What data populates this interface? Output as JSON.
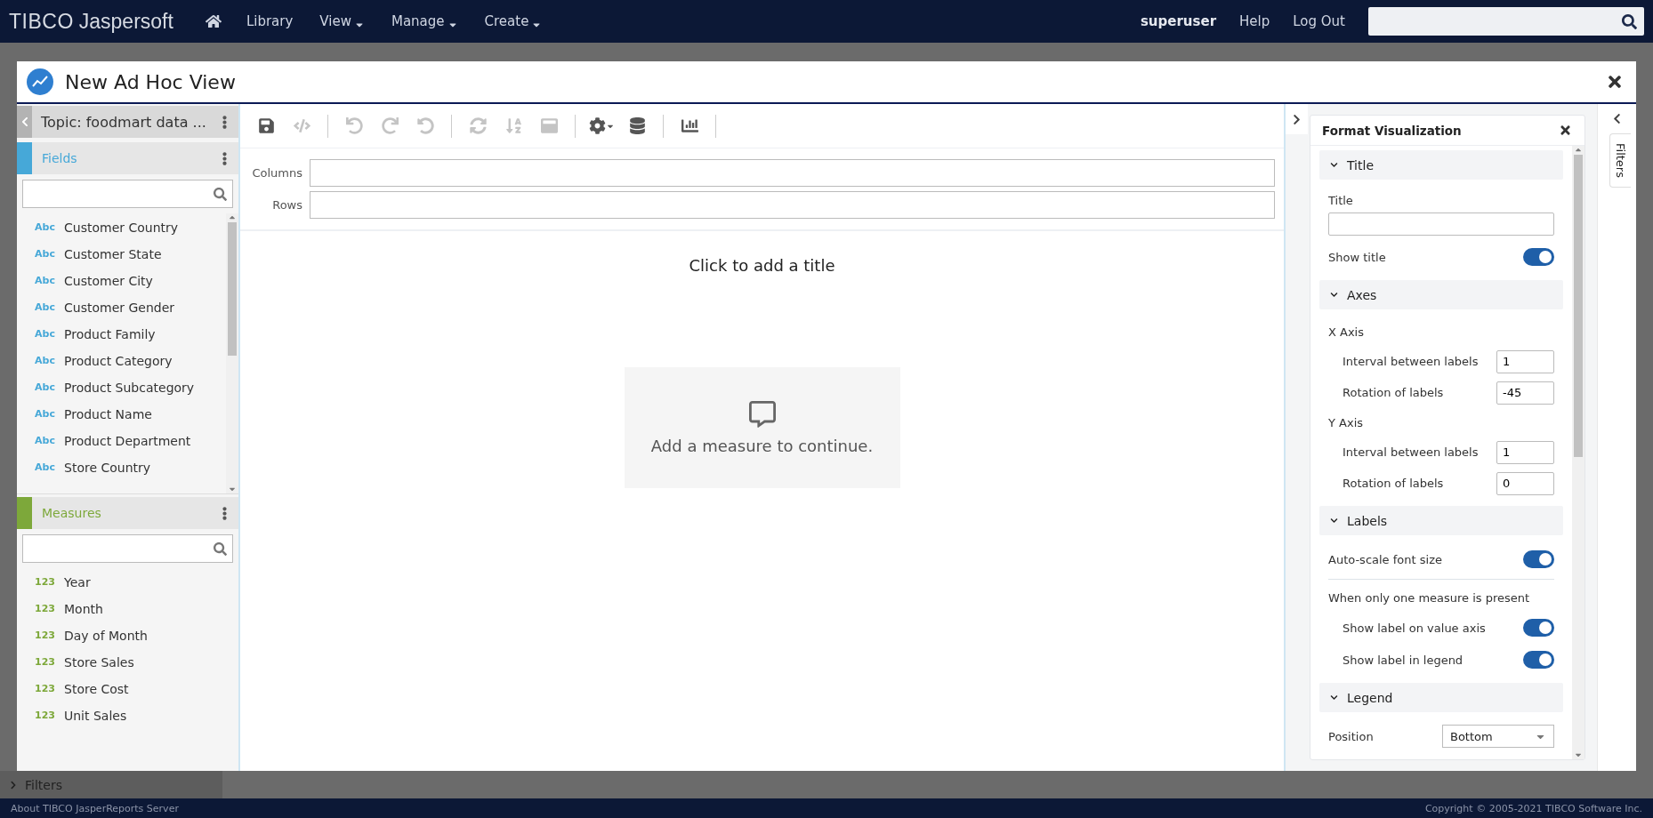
{
  "topbar": {
    "logo": {
      "brand": "TIBCO",
      "product": "Jaspersoft"
    },
    "nav": [
      {
        "label": "Library",
        "has_menu": false
      },
      {
        "label": "View",
        "has_menu": true
      },
      {
        "label": "Manage",
        "has_menu": true
      },
      {
        "label": "Create",
        "has_menu": true
      }
    ],
    "user": "superuser",
    "links": [
      "Help",
      "Log Out"
    ]
  },
  "background": {
    "filters_label": "Filters"
  },
  "dialog": {
    "title": "New Ad Hoc View",
    "data_panel": {
      "topic": "Topic: foodmart data ...",
      "sections": [
        {
          "title": "Fields",
          "color": "#46a8d8",
          "items": [
            {
              "type": "Abc",
              "name": "Customer Country"
            },
            {
              "type": "Abc",
              "name": "Customer State"
            },
            {
              "type": "Abc",
              "name": "Customer City"
            },
            {
              "type": "Abc",
              "name": "Customer Gender"
            },
            {
              "type": "Abc",
              "name": "Product Family"
            },
            {
              "type": "Abc",
              "name": "Product Category"
            },
            {
              "type": "Abc",
              "name": "Product Subcategory"
            },
            {
              "type": "Abc",
              "name": "Product Name"
            },
            {
              "type": "Abc",
              "name": "Product Department"
            },
            {
              "type": "Abc",
              "name": "Store Country"
            }
          ]
        },
        {
          "title": "Measures",
          "color": "#7da83a",
          "items": [
            {
              "type": "123",
              "name": "Year"
            },
            {
              "type": "123",
              "name": "Month"
            },
            {
              "type": "123",
              "name": "Day of Month"
            },
            {
              "type": "123",
              "name": "Store Sales"
            },
            {
              "type": "123",
              "name": "Store Cost"
            },
            {
              "type": "123",
              "name": "Unit Sales"
            }
          ]
        }
      ]
    },
    "toolbar": [
      [
        {
          "kind": "save",
          "disabled": false
        },
        {
          "kind": "code",
          "disabled": true
        }
      ],
      [
        {
          "kind": "undo",
          "disabled": true
        },
        {
          "kind": "redo",
          "disabled": true
        },
        {
          "kind": "undo_all",
          "disabled": true
        }
      ],
      [
        {
          "kind": "pivot",
          "disabled": true
        },
        {
          "kind": "sort",
          "disabled": true
        },
        {
          "kind": "layout",
          "disabled": true
        }
      ],
      [
        {
          "kind": "settings",
          "disabled": false
        },
        {
          "kind": "data_info",
          "disabled": false
        }
      ],
      [
        {
          "kind": "chart",
          "disabled": false
        }
      ]
    ],
    "axes": [
      {
        "label": "Columns"
      },
      {
        "label": "Rows"
      }
    ],
    "canvas": {
      "title_hint": "Click to add a title",
      "message": "Add a measure to continue."
    },
    "format_panel": {
      "title": "Format Visualization",
      "sections": [
        {
          "title": "Title",
          "expanded": true,
          "rows": [
            {
              "kind": "field",
              "label": "Title",
              "value": ""
            },
            {
              "kind": "toggle",
              "label": "Show title",
              "on": true
            }
          ]
        },
        {
          "title": "Axes",
          "expanded": true,
          "rows": [
            {
              "kind": "group",
              "label": "X Axis",
              "children": [
                {
                  "kind": "number",
                  "label": "Interval between labels",
                  "value": "1"
                },
                {
                  "kind": "number",
                  "label": "Rotation of labels",
                  "value": "-45"
                }
              ]
            },
            {
              "kind": "group",
              "label": "Y Axis",
              "children": [
                {
                  "kind": "number",
                  "label": "Interval between labels",
                  "value": "1"
                },
                {
                  "kind": "number",
                  "label": "Rotation of labels",
                  "value": "0"
                }
              ]
            }
          ]
        },
        {
          "title": "Labels",
          "expanded": true,
          "rows": [
            {
              "kind": "toggle",
              "label": "Auto-scale font size",
              "on": true
            },
            {
              "kind": "divider"
            },
            {
              "kind": "group",
              "label": "When only one measure is present",
              "children": [
                {
                  "kind": "toggle",
                  "label": "Show label on value axis",
                  "on": true
                },
                {
                  "kind": "toggle",
                  "label": "Show label in legend",
                  "on": true
                }
              ]
            }
          ]
        },
        {
          "title": "Legend",
          "expanded": true,
          "rows": [
            {
              "kind": "select",
              "label": "Position",
              "value": "Bottom"
            }
          ]
        }
      ]
    },
    "side_tab": "Filters"
  },
  "footer": {
    "about": "About TIBCO JasperReports Server",
    "copyright": "Copyright © 2005-2021 TIBCO Software Inc."
  }
}
